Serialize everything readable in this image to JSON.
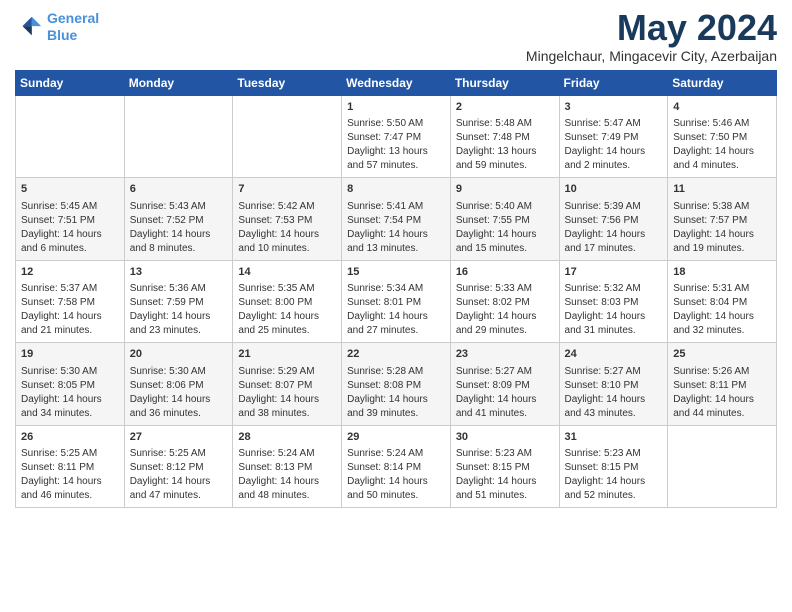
{
  "logo": {
    "line1": "General",
    "line2": "Blue"
  },
  "title": "May 2024",
  "location": "Mingelchaur, Mingacevir City, Azerbaijan",
  "days_of_week": [
    "Sunday",
    "Monday",
    "Tuesday",
    "Wednesday",
    "Thursday",
    "Friday",
    "Saturday"
  ],
  "weeks": [
    [
      {
        "day": "",
        "sunrise": "",
        "sunset": "",
        "daylight": ""
      },
      {
        "day": "",
        "sunrise": "",
        "sunset": "",
        "daylight": ""
      },
      {
        "day": "",
        "sunrise": "",
        "sunset": "",
        "daylight": ""
      },
      {
        "day": "1",
        "sunrise": "Sunrise: 5:50 AM",
        "sunset": "Sunset: 7:47 PM",
        "daylight": "Daylight: 13 hours and 57 minutes."
      },
      {
        "day": "2",
        "sunrise": "Sunrise: 5:48 AM",
        "sunset": "Sunset: 7:48 PM",
        "daylight": "Daylight: 13 hours and 59 minutes."
      },
      {
        "day": "3",
        "sunrise": "Sunrise: 5:47 AM",
        "sunset": "Sunset: 7:49 PM",
        "daylight": "Daylight: 14 hours and 2 minutes."
      },
      {
        "day": "4",
        "sunrise": "Sunrise: 5:46 AM",
        "sunset": "Sunset: 7:50 PM",
        "daylight": "Daylight: 14 hours and 4 minutes."
      }
    ],
    [
      {
        "day": "5",
        "sunrise": "Sunrise: 5:45 AM",
        "sunset": "Sunset: 7:51 PM",
        "daylight": "Daylight: 14 hours and 6 minutes."
      },
      {
        "day": "6",
        "sunrise": "Sunrise: 5:43 AM",
        "sunset": "Sunset: 7:52 PM",
        "daylight": "Daylight: 14 hours and 8 minutes."
      },
      {
        "day": "7",
        "sunrise": "Sunrise: 5:42 AM",
        "sunset": "Sunset: 7:53 PM",
        "daylight": "Daylight: 14 hours and 10 minutes."
      },
      {
        "day": "8",
        "sunrise": "Sunrise: 5:41 AM",
        "sunset": "Sunset: 7:54 PM",
        "daylight": "Daylight: 14 hours and 13 minutes."
      },
      {
        "day": "9",
        "sunrise": "Sunrise: 5:40 AM",
        "sunset": "Sunset: 7:55 PM",
        "daylight": "Daylight: 14 hours and 15 minutes."
      },
      {
        "day": "10",
        "sunrise": "Sunrise: 5:39 AM",
        "sunset": "Sunset: 7:56 PM",
        "daylight": "Daylight: 14 hours and 17 minutes."
      },
      {
        "day": "11",
        "sunrise": "Sunrise: 5:38 AM",
        "sunset": "Sunset: 7:57 PM",
        "daylight": "Daylight: 14 hours and 19 minutes."
      }
    ],
    [
      {
        "day": "12",
        "sunrise": "Sunrise: 5:37 AM",
        "sunset": "Sunset: 7:58 PM",
        "daylight": "Daylight: 14 hours and 21 minutes."
      },
      {
        "day": "13",
        "sunrise": "Sunrise: 5:36 AM",
        "sunset": "Sunset: 7:59 PM",
        "daylight": "Daylight: 14 hours and 23 minutes."
      },
      {
        "day": "14",
        "sunrise": "Sunrise: 5:35 AM",
        "sunset": "Sunset: 8:00 PM",
        "daylight": "Daylight: 14 hours and 25 minutes."
      },
      {
        "day": "15",
        "sunrise": "Sunrise: 5:34 AM",
        "sunset": "Sunset: 8:01 PM",
        "daylight": "Daylight: 14 hours and 27 minutes."
      },
      {
        "day": "16",
        "sunrise": "Sunrise: 5:33 AM",
        "sunset": "Sunset: 8:02 PM",
        "daylight": "Daylight: 14 hours and 29 minutes."
      },
      {
        "day": "17",
        "sunrise": "Sunrise: 5:32 AM",
        "sunset": "Sunset: 8:03 PM",
        "daylight": "Daylight: 14 hours and 31 minutes."
      },
      {
        "day": "18",
        "sunrise": "Sunrise: 5:31 AM",
        "sunset": "Sunset: 8:04 PM",
        "daylight": "Daylight: 14 hours and 32 minutes."
      }
    ],
    [
      {
        "day": "19",
        "sunrise": "Sunrise: 5:30 AM",
        "sunset": "Sunset: 8:05 PM",
        "daylight": "Daylight: 14 hours and 34 minutes."
      },
      {
        "day": "20",
        "sunrise": "Sunrise: 5:30 AM",
        "sunset": "Sunset: 8:06 PM",
        "daylight": "Daylight: 14 hours and 36 minutes."
      },
      {
        "day": "21",
        "sunrise": "Sunrise: 5:29 AM",
        "sunset": "Sunset: 8:07 PM",
        "daylight": "Daylight: 14 hours and 38 minutes."
      },
      {
        "day": "22",
        "sunrise": "Sunrise: 5:28 AM",
        "sunset": "Sunset: 8:08 PM",
        "daylight": "Daylight: 14 hours and 39 minutes."
      },
      {
        "day": "23",
        "sunrise": "Sunrise: 5:27 AM",
        "sunset": "Sunset: 8:09 PM",
        "daylight": "Daylight: 14 hours and 41 minutes."
      },
      {
        "day": "24",
        "sunrise": "Sunrise: 5:27 AM",
        "sunset": "Sunset: 8:10 PM",
        "daylight": "Daylight: 14 hours and 43 minutes."
      },
      {
        "day": "25",
        "sunrise": "Sunrise: 5:26 AM",
        "sunset": "Sunset: 8:11 PM",
        "daylight": "Daylight: 14 hours and 44 minutes."
      }
    ],
    [
      {
        "day": "26",
        "sunrise": "Sunrise: 5:25 AM",
        "sunset": "Sunset: 8:11 PM",
        "daylight": "Daylight: 14 hours and 46 minutes."
      },
      {
        "day": "27",
        "sunrise": "Sunrise: 5:25 AM",
        "sunset": "Sunset: 8:12 PM",
        "daylight": "Daylight: 14 hours and 47 minutes."
      },
      {
        "day": "28",
        "sunrise": "Sunrise: 5:24 AM",
        "sunset": "Sunset: 8:13 PM",
        "daylight": "Daylight: 14 hours and 48 minutes."
      },
      {
        "day": "29",
        "sunrise": "Sunrise: 5:24 AM",
        "sunset": "Sunset: 8:14 PM",
        "daylight": "Daylight: 14 hours and 50 minutes."
      },
      {
        "day": "30",
        "sunrise": "Sunrise: 5:23 AM",
        "sunset": "Sunset: 8:15 PM",
        "daylight": "Daylight: 14 hours and 51 minutes."
      },
      {
        "day": "31",
        "sunrise": "Sunrise: 5:23 AM",
        "sunset": "Sunset: 8:15 PM",
        "daylight": "Daylight: 14 hours and 52 minutes."
      },
      {
        "day": "",
        "sunrise": "",
        "sunset": "",
        "daylight": ""
      }
    ]
  ]
}
